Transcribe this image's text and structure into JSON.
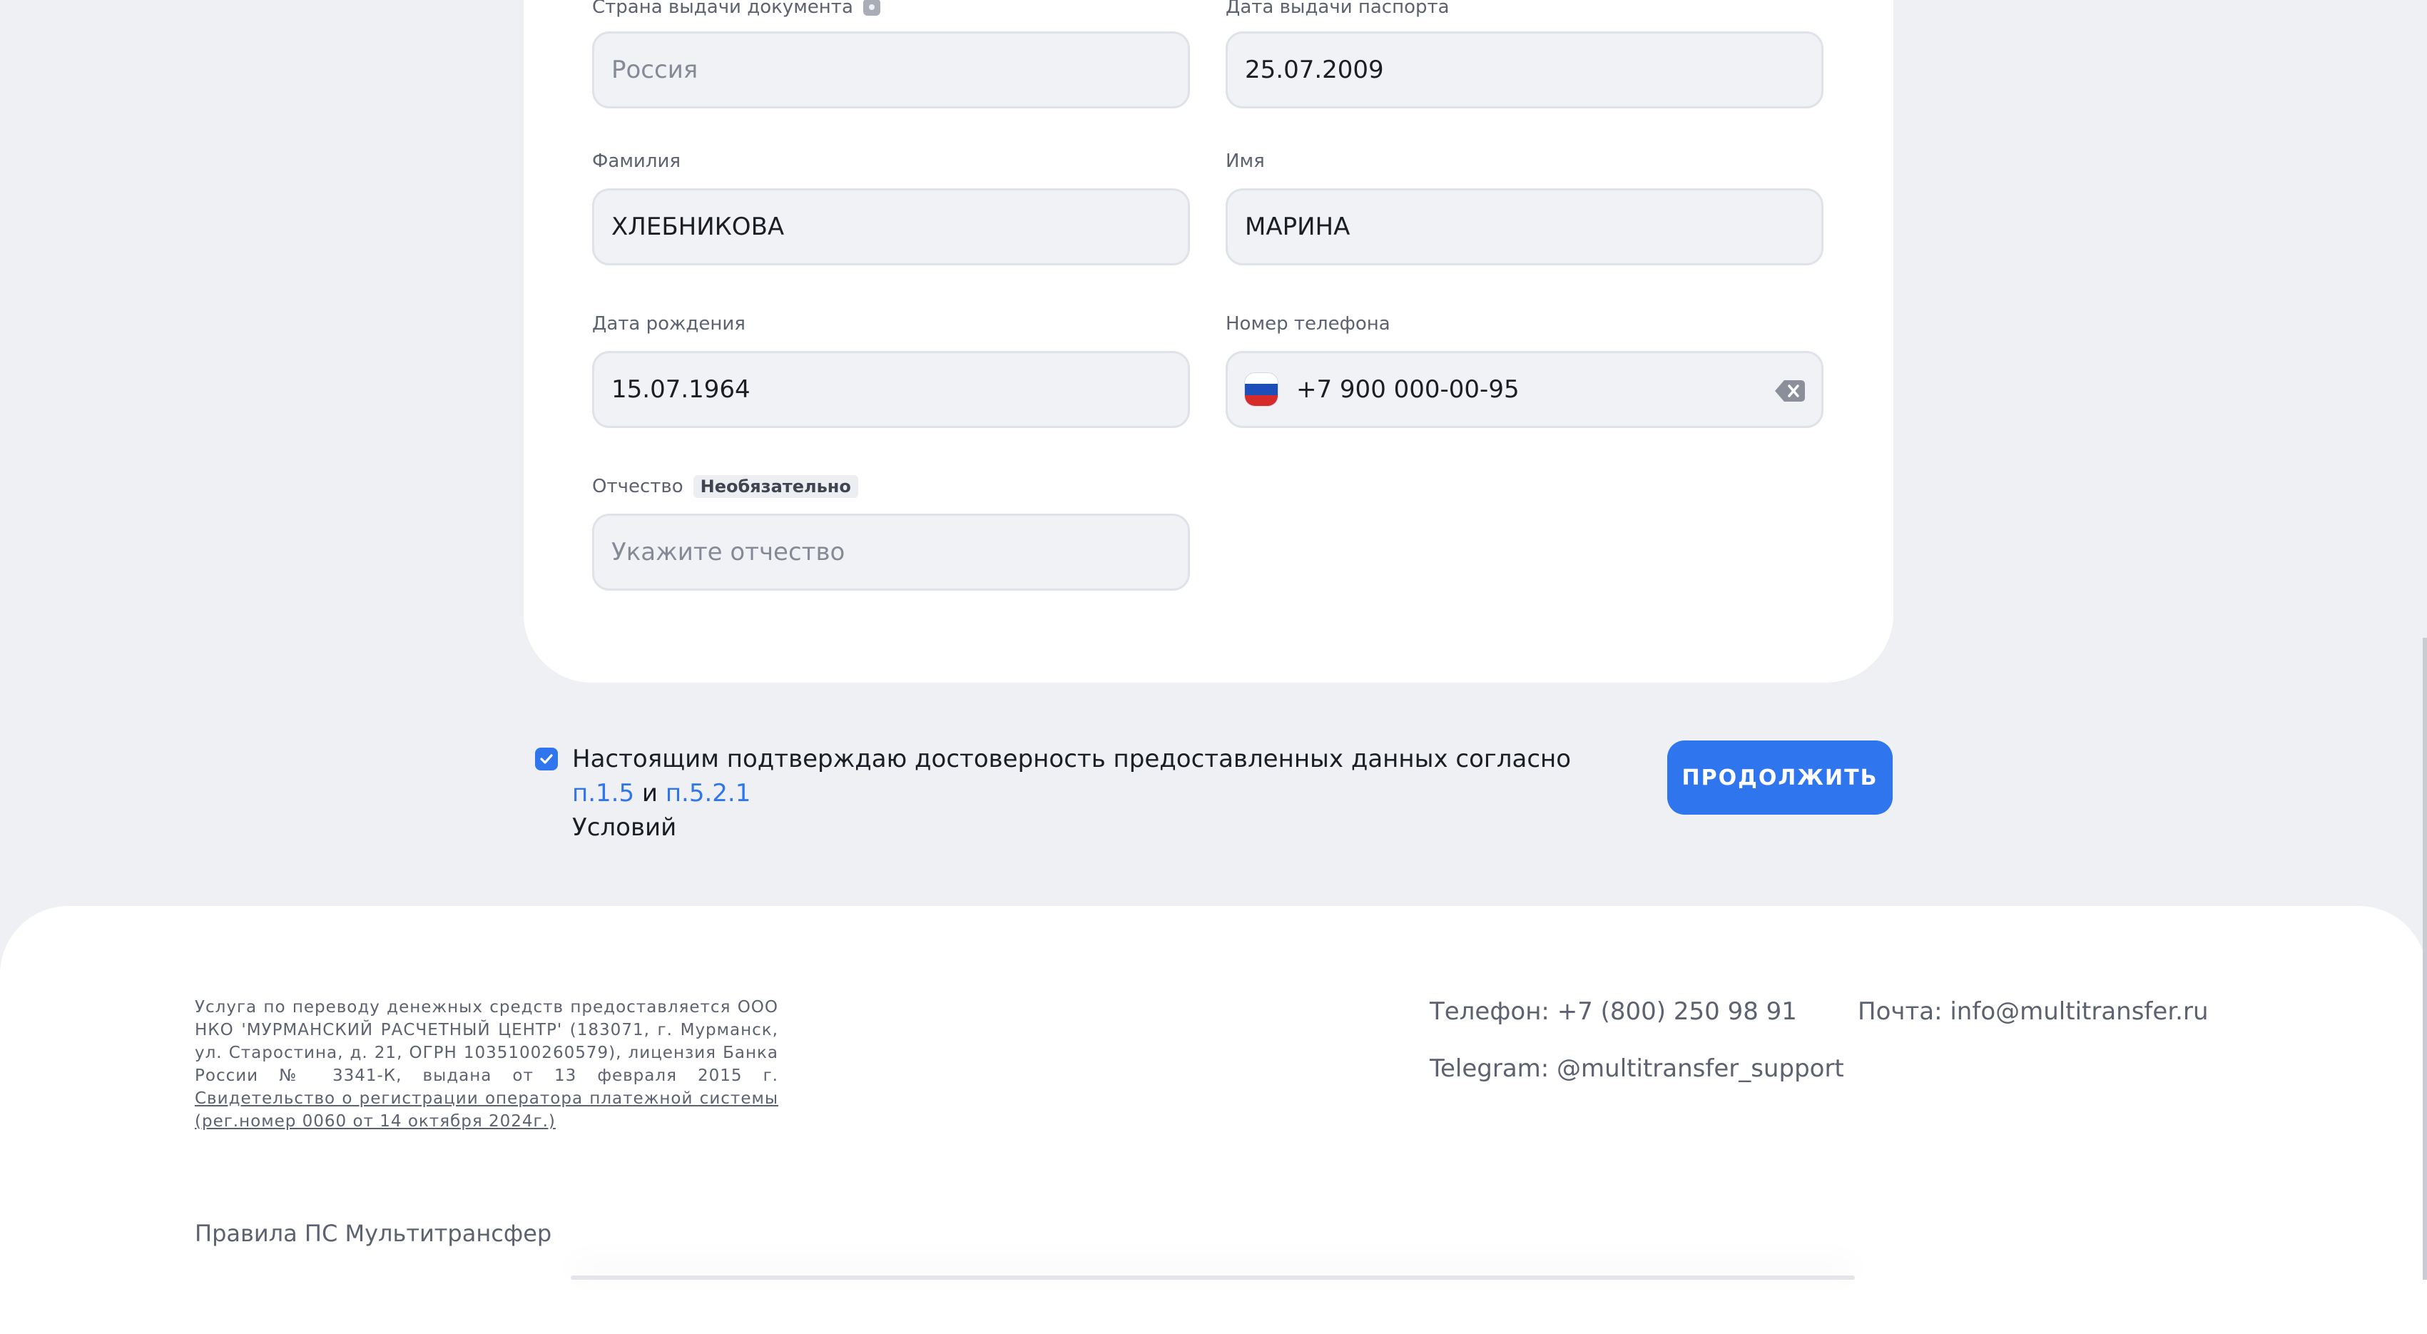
{
  "form": {
    "country": {
      "label": "Страна выдачи документа",
      "placeholder": "Россия"
    },
    "issue_date": {
      "label": "Дата выдачи паспорта",
      "value": "25.07.2009"
    },
    "surname": {
      "label": "Фамилия",
      "value": "ХЛЕБНИКОВА"
    },
    "name": {
      "label": "Имя",
      "value": "МАРИНА"
    },
    "birth_date": {
      "label": "Дата рождения",
      "value": "15.07.1964"
    },
    "phone": {
      "label": "Номер телефона",
      "value": "+7 900 000-00-95"
    },
    "patronymic": {
      "label": "Отчество",
      "optional_badge": "Необязательно",
      "placeholder": "Укажите отчество"
    }
  },
  "consent": {
    "checked": true,
    "text_before": "Настоящим подтверждаю достоверность предоставленных данных согласно ",
    "link1": "п.1.5",
    "and": " и ",
    "link2": "п.5.2.1",
    "text_after": "Условий"
  },
  "continue_button": "ПРОДОЛЖИТЬ",
  "footer": {
    "legal_text": "Услуга по переводу денежных средств предоставляется ООО НКО 'МУРМАНСКИЙ РАСЧЕТНЫЙ ЦЕНТР' (183071, г. Мурманск, ул. Старостина, д. 21, ОГРН 1035100260579), лицензия Банка России № 3341-К, выдана от 13 февраля 2015 г. ",
    "legal_link": "Свидетельство о регистрации оператора платежной системы (рег.номер 0060 от 14 октября 2024г.)",
    "phone": "Телефон: +7 (800) 250 98 91",
    "email": "Почта: info@multitransfer.ru",
    "telegram": "Telegram: @multitransfer_support",
    "rules_link": "Правила ПС Мультитрансфер"
  },
  "colors": {
    "accent": "#2f75ee",
    "background": "#eef0f4",
    "field_bg": "#f1f2f6"
  },
  "icons": [
    "lock-icon",
    "russia-flag-icon",
    "clear-icon",
    "checkmark-icon"
  ]
}
